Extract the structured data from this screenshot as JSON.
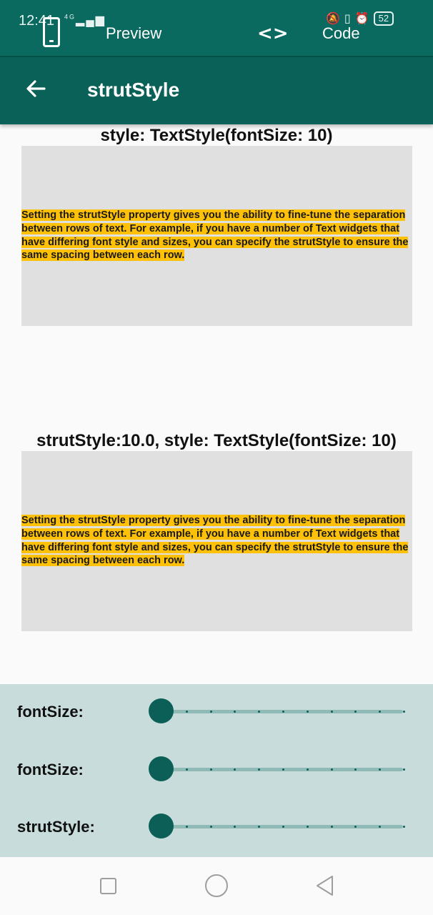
{
  "status_bar": {
    "time": "12:41",
    "network": "4G",
    "battery": "52"
  },
  "preview_bar": {
    "preview_label": "Preview",
    "code_label": "Code",
    "code_icon": "<>"
  },
  "app_bar": {
    "title": "strutStyle"
  },
  "sections": [
    {
      "title": "style: TextStyle(fontSize: 10)",
      "text": "Setting the strutStyle property gives you the ability to fine-tune the separation between rows of text. For example, if you have a number of Text widgets that have differing font style and sizes, you can specify the strutStyle to ensure the same spacing between each row."
    },
    {
      "title": "strutStyle:10.0, style: TextStyle(fontSize: 10)",
      "text": "Setting the strutStyle property gives you the ability to fine-tune the separation between rows of text. For example, if you have a number of Text widgets that have differing font style and sizes, you can specify the strutStyle to ensure the same spacing between each row."
    }
  ],
  "controls": [
    {
      "label": "fontSize:",
      "value": 0
    },
    {
      "label": "fontSize:",
      "value": 0
    },
    {
      "label": "strutStyle:",
      "value": 0
    }
  ],
  "colors": {
    "primary": "#0a6157",
    "highlight": "#ffc107",
    "panel": "#c8dcdc"
  }
}
